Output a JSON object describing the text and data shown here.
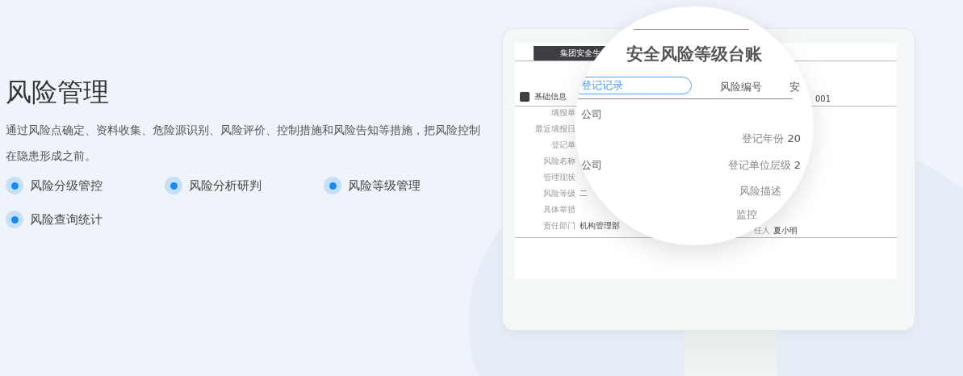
{
  "intro": {
    "title": "风险管理",
    "description": "通过风险点确定、资料收集、危险源识别、风险评价、控制措施和风险告知等措施，把风险控制在隐患形成之前。",
    "features": [
      {
        "label": "风险分级管控"
      },
      {
        "label": "风险分析研判"
      },
      {
        "label": "风险等级管理"
      },
      {
        "label": "风险查询统计"
      }
    ]
  },
  "screen": {
    "tab": "集团安全生",
    "section": "基础信息",
    "code_fragment": "001",
    "rows": [
      {
        "label": "填报单",
        "value": ""
      },
      {
        "label": "最近填报日",
        "value": ""
      },
      {
        "label": "登记单",
        "value": ""
      },
      {
        "label": "风险名称",
        "value": ""
      },
      {
        "label": "管理现状",
        "value": ""
      },
      {
        "label": "风险等级",
        "value": "二"
      },
      {
        "label": "具体举措",
        "value": ""
      },
      {
        "label": "责任部门",
        "value": "机构管理部"
      }
    ],
    "responsible_label": "任人",
    "responsible_value": "夏小明"
  },
  "magnifier": {
    "title": "安全风险等级台账",
    "tab": {
      "label": "登记记录",
      "selected": true
    },
    "column_header": "风险编号",
    "header_fragment": "安",
    "left_values": [
      "公司",
      "公司"
    ],
    "fields": [
      {
        "label": "登记年份",
        "value": "20"
      },
      {
        "label": "登记单位层级",
        "value": "2"
      },
      {
        "label": "风险描述"
      },
      {
        "label": "监控"
      }
    ]
  }
}
